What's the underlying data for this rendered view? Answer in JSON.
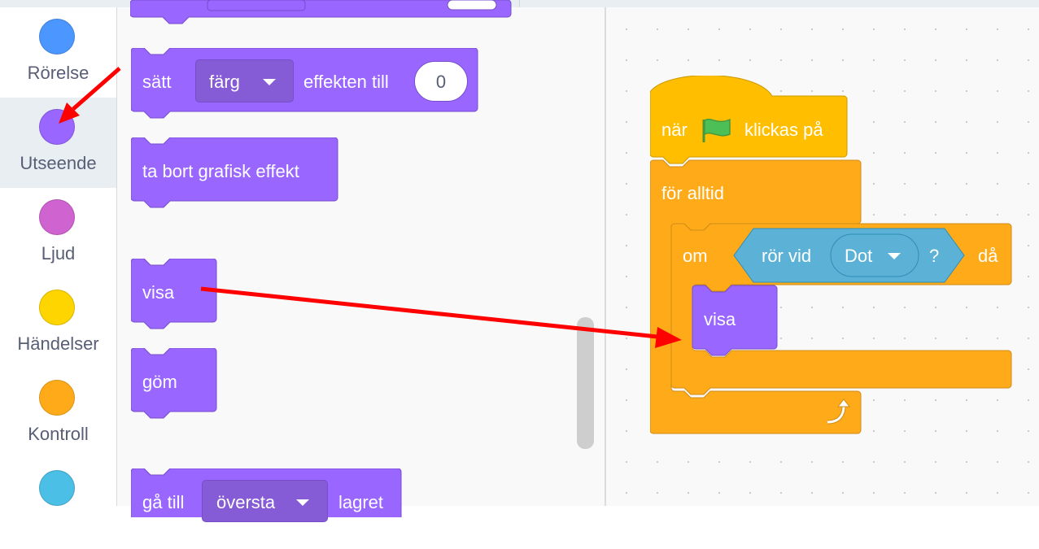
{
  "colors": {
    "looks": "#9966ff",
    "looks_dark": "#774dcb",
    "control": "#ffab19",
    "control_dark": "#cf8b17",
    "events": "#ffbf00",
    "sensing": "#5cb1d6",
    "sensing_dark": "#2e8eb8",
    "arrow": "#ff0000"
  },
  "categories": [
    {
      "label": "Rörelse",
      "color": "#4c97ff",
      "selected": false
    },
    {
      "label": "Utseende",
      "color": "#9966ff",
      "selected": true
    },
    {
      "label": "Ljud",
      "color": "#cf63cf",
      "selected": false
    },
    {
      "label": "Händelser",
      "color": "#ffd500",
      "selected": false
    },
    {
      "label": "Kontroll",
      "color": "#ffab19",
      "selected": false
    },
    {
      "label": "",
      "color": "#4cbfe6",
      "selected": false
    }
  ],
  "palette": {
    "set_effect": {
      "word1": "sätt",
      "dropdown": "färg",
      "word2": "effekten till",
      "value": "0"
    },
    "clear_effects": "ta bort grafisk effekt",
    "show": "visa",
    "hide": "göm",
    "go_to_layer": {
      "word1": "gå till",
      "dropdown": "översta",
      "word2": "lagret"
    }
  },
  "script": {
    "hat": {
      "word1": "när",
      "icon": "green-flag-icon",
      "word2": "klickas på"
    },
    "forever": "för alltid",
    "if": {
      "word1": "om",
      "word2": "då"
    },
    "touching": {
      "word1": "rör vid",
      "dropdown": "Dot",
      "word2": "?"
    },
    "inner_show": "visa",
    "loop_icon": "loop-arrow-icon"
  }
}
